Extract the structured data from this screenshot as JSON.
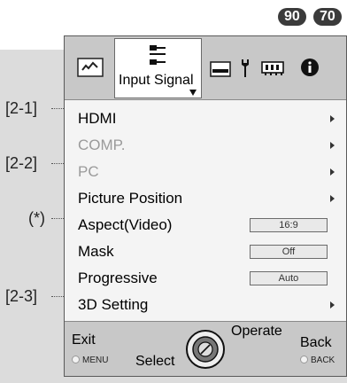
{
  "badges": [
    "90",
    "70"
  ],
  "callouts": {
    "c1": "[2-1]",
    "c2": "[2-2]",
    "c3": "(*)",
    "c4": "[2-3]"
  },
  "tabs": {
    "active_label": "Input Signal"
  },
  "menu": {
    "items": [
      {
        "label": "HDMI"
      },
      {
        "label": "COMP."
      },
      {
        "label": "PC"
      },
      {
        "label": "Picture Position"
      },
      {
        "label": "Aspect(Video)",
        "value": "16:9"
      },
      {
        "label": "Mask",
        "value": "Off"
      },
      {
        "label": "Progressive",
        "value": "Auto"
      },
      {
        "label": "3D Setting"
      }
    ]
  },
  "footer": {
    "exit": "Exit",
    "menu_key": "MENU",
    "select": "Select",
    "operate": "Operate",
    "back": "Back",
    "back_key": "BACK"
  }
}
